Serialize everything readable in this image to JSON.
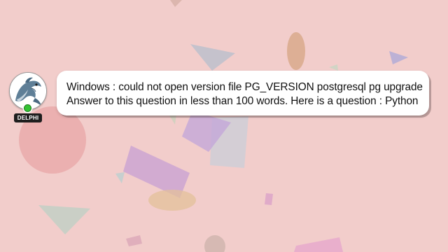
{
  "colors": {
    "background": "#f2cdcb",
    "bubble": "#ffffff",
    "text": "#111111",
    "status": "#34c234",
    "name_tag": "#1e1e1e"
  },
  "avatar": {
    "icon": "dolphin-icon",
    "name": "DELPHI",
    "status": "online"
  },
  "message": {
    "line1": "Windows : could not open version file PG_VERSION postgresql pg upgrade",
    "line2": "Answer to this question in less than 100 words. Here is a question : Python"
  }
}
